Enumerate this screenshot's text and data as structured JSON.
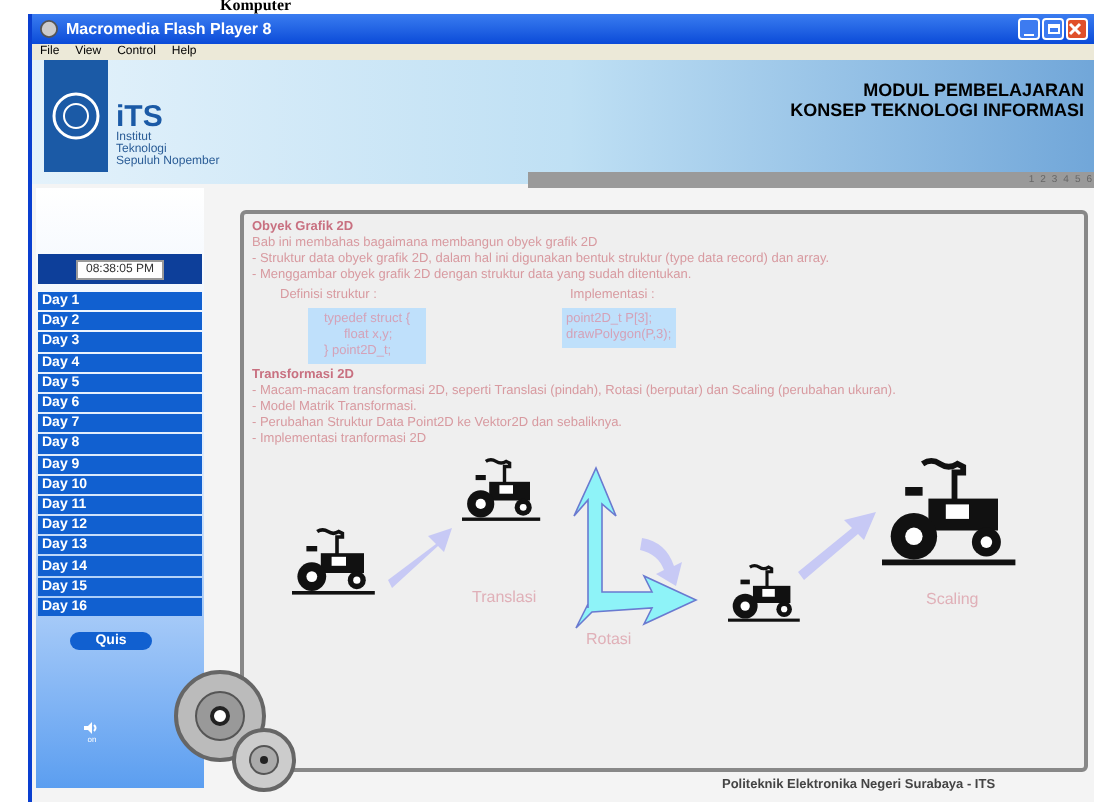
{
  "doc_heading": "Komputer",
  "window": {
    "title": "Macromedia Flash Player 8"
  },
  "menu": [
    "File",
    "View",
    "Control",
    "Help"
  ],
  "banner": {
    "logo_text": "iTS",
    "institution": [
      "Institut",
      "Teknologi",
      "Sepuluh Nopember"
    ],
    "title_lines": [
      "MODUL PEMBELAJARAN",
      "KONSEP TEKNOLOGI INFORMASI"
    ],
    "pages": [
      "1",
      "2",
      "3",
      "4",
      "5",
      "6"
    ]
  },
  "clock": "08:38:05 PM",
  "days": [
    "Day 1",
    "Day 2",
    "Day 3",
    "Day 4",
    "Day 5",
    "Day 6",
    "Day 7",
    "Day 8",
    "Day 9",
    "Day 10",
    "Day 11",
    "Day 12",
    "Day 13",
    "Day 14",
    "Day 15",
    "Day 16"
  ],
  "quiz_button": "Quis",
  "sound_label": "on",
  "content": {
    "section_1": {
      "title": "Obyek Grafik 2D",
      "lines": [
        "Bab ini membahas bagaimana membangun obyek grafik 2D",
        "- Struktur data obyek grafik 2D, dalam hal ini digunakan bentuk struktur (type data record) dan array.",
        "- Menggambar obyek grafik 2D dengan struktur data yang sudah ditentukan."
      ]
    },
    "definition": {
      "label": "Definisi struktur :",
      "code": [
        "typedef struct {",
        "float x,y;",
        "} point2D_t;"
      ]
    },
    "implementation": {
      "label": "Implementasi :",
      "code": [
        "point2D_t P[3];",
        "drawPolygon(P,3);"
      ]
    },
    "section_2": {
      "title": "Transformasi 2D",
      "lines": [
        "- Macam-macam transformasi 2D, seperti Translasi (pindah), Rotasi (berputar) dan Scaling (perubahan ukuran).",
        "- Model Matrik Transformasi.",
        "- Perubahan Struktur Data Point2D ke Vektor2D dan sebaliknya.",
        "- Implementasi tranformasi 2D"
      ]
    },
    "diagram_labels": [
      "Translasi",
      "Rotasi",
      "Scaling"
    ]
  },
  "footer": "Politeknik Elektronika Negeri Surabaya - ITS"
}
